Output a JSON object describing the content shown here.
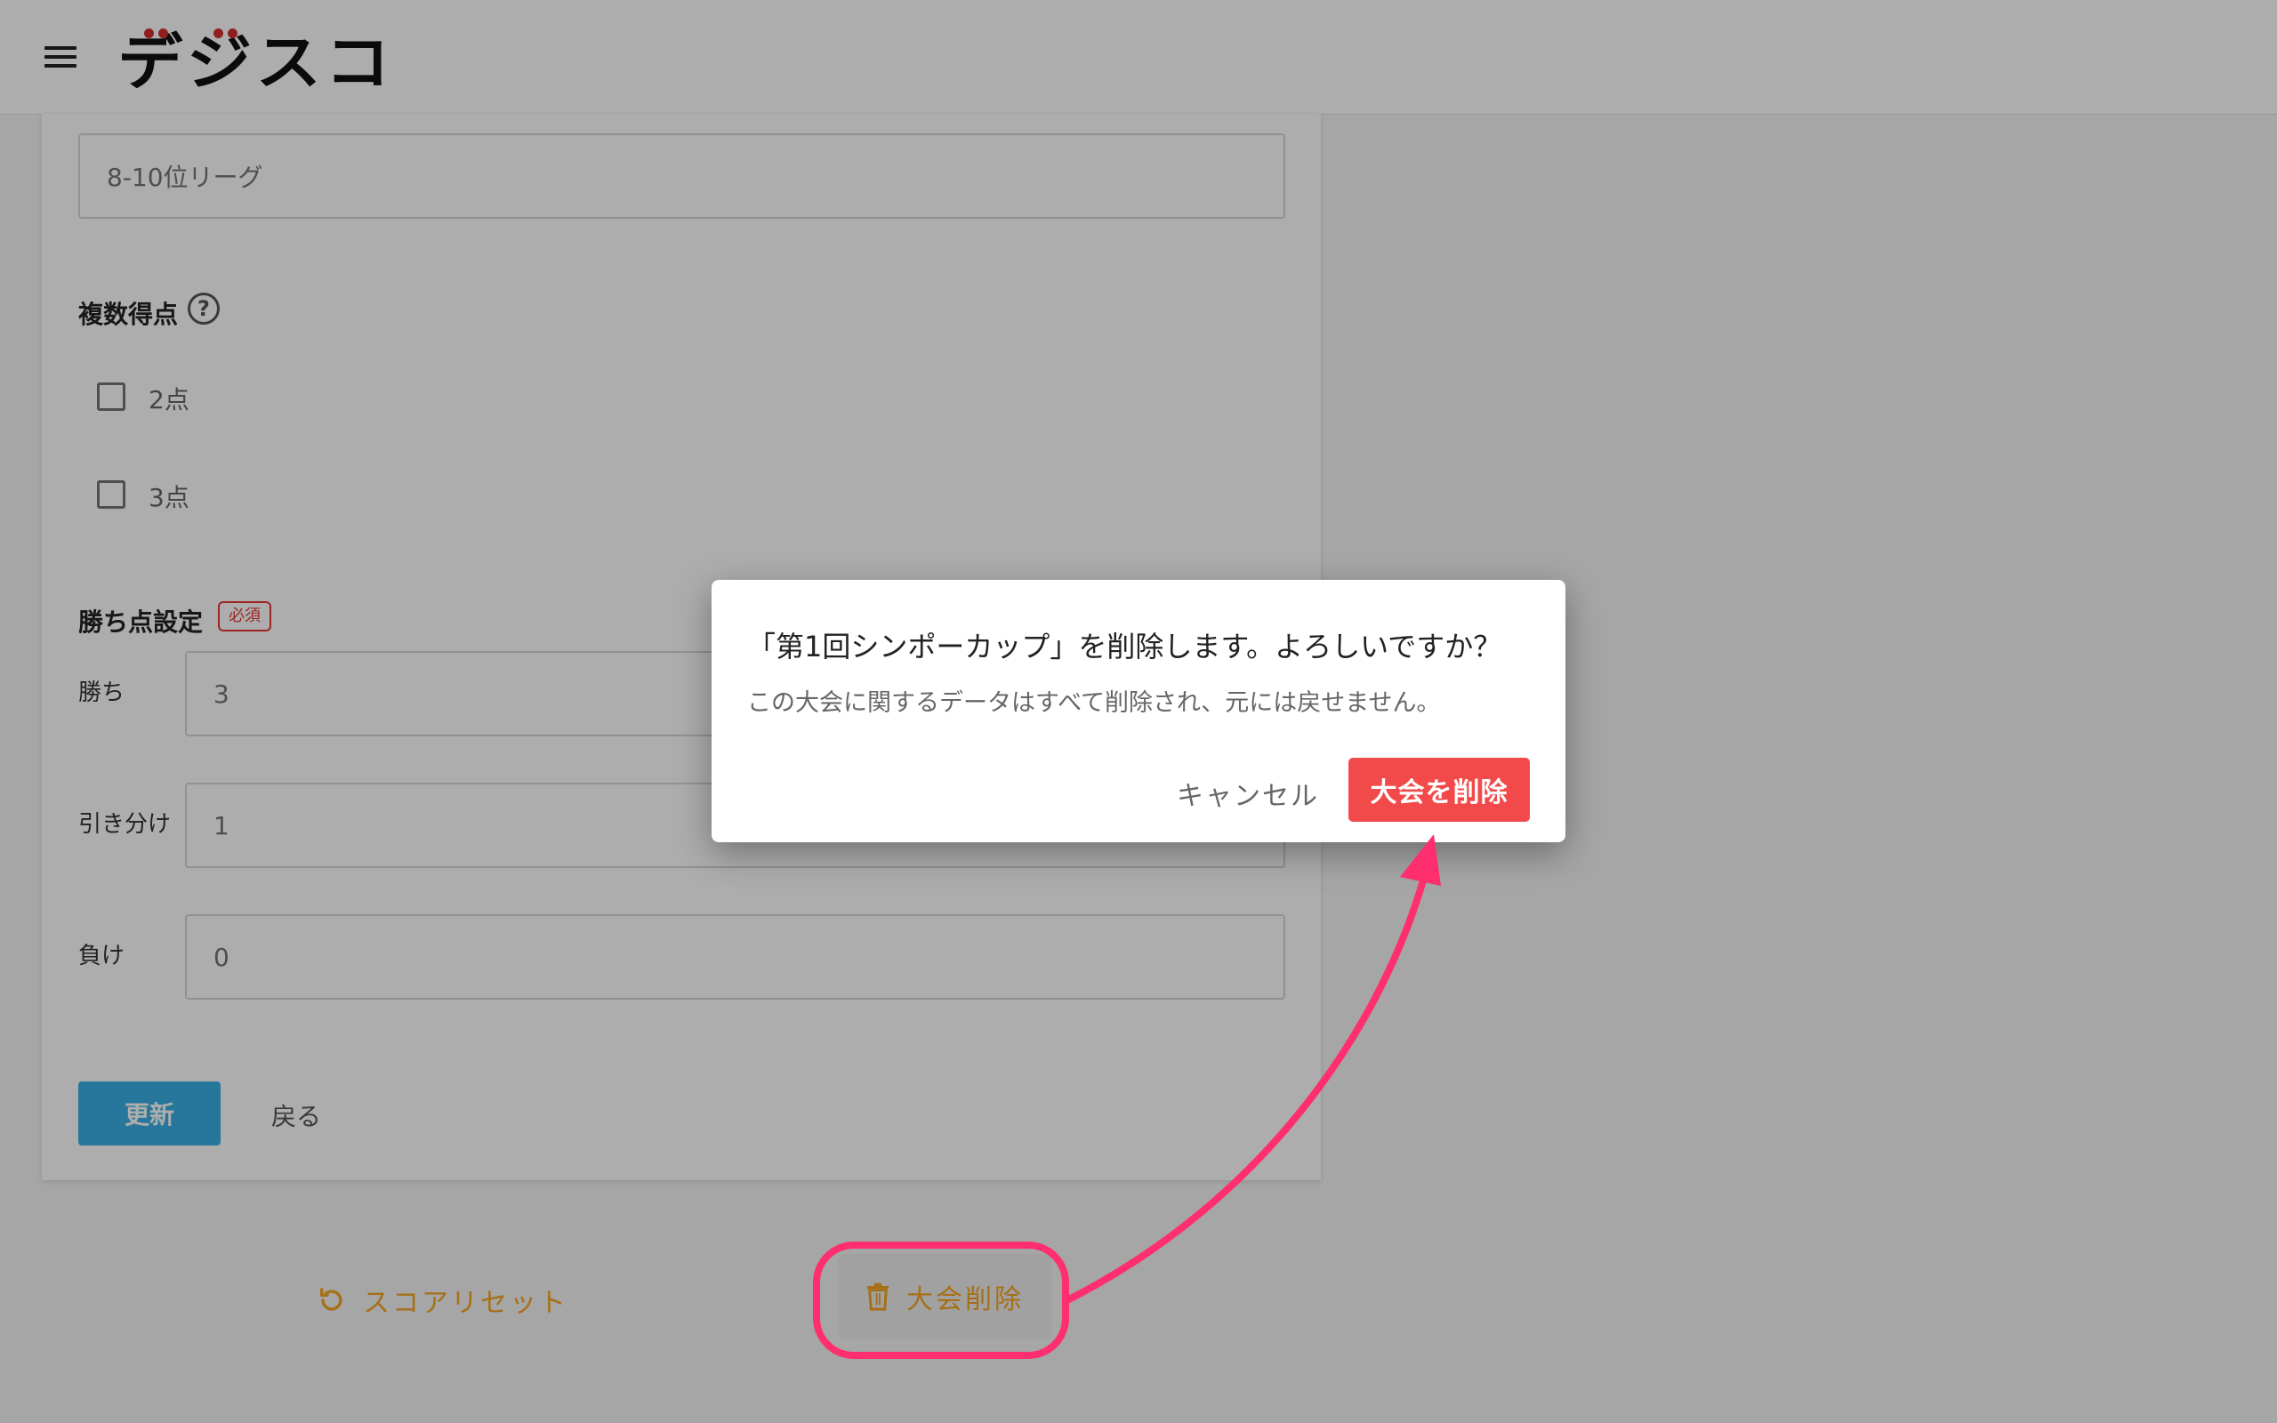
{
  "header": {
    "logo_text": "デジスコ"
  },
  "form": {
    "league_name_value": "8-10位リーグ",
    "multi_score": {
      "title": "複数得点",
      "help_icon": "question-circle-icon",
      "options": [
        {
          "label": "2点",
          "checked": false
        },
        {
          "label": "3点",
          "checked": false
        }
      ]
    },
    "win_points": {
      "title": "勝ち点設定",
      "required_badge": "必須",
      "win_label": "勝ち",
      "win_value": "3",
      "draw_label": "引き分け",
      "draw_value": "1",
      "loss_label": "負け",
      "loss_value": "0"
    },
    "update_button": "更新",
    "back_button": "戻る"
  },
  "bottom_actions": {
    "score_reset": {
      "label": "スコアリセット",
      "icon": "refresh-icon",
      "color": "#f5a623"
    },
    "delete_tournament": {
      "label": "大会削除",
      "icon": "trash-icon",
      "color": "#f5a623"
    }
  },
  "dialog": {
    "title": "「第1回シンポーカップ」を削除します。よろしいですか？",
    "body": "この大会に関するデータはすべて削除され、元には戻せません。",
    "cancel_label": "キャンセル",
    "delete_label": "大会を削除",
    "delete_color": "#f24a4a"
  },
  "annotation": {
    "color": "#ff2e6e"
  }
}
